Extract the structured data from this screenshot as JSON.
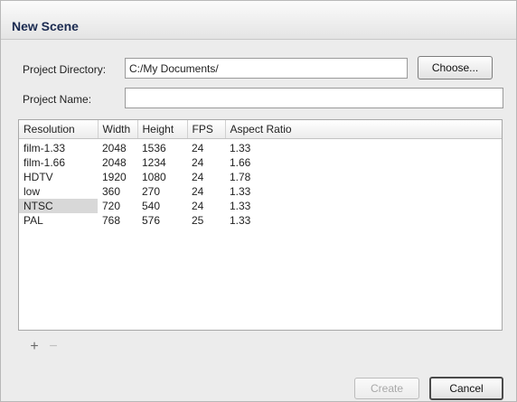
{
  "dialog": {
    "title": "New Scene"
  },
  "project_directory": {
    "label": "Project Directory:",
    "value": "C:/My Documents/"
  },
  "project_name": {
    "label": "Project Name:",
    "value": ""
  },
  "choose_button": "Choose...",
  "table": {
    "columns": [
      "Resolution",
      "Width",
      "Height",
      "FPS",
      "Aspect Ratio"
    ],
    "rows": [
      [
        "film-1.33",
        "2048",
        "1536",
        "24",
        "1.33"
      ],
      [
        "film-1.66",
        "2048",
        "1234",
        "24",
        "1.66"
      ],
      [
        "HDTV",
        "1920",
        "1080",
        "24",
        "1.78"
      ],
      [
        "low",
        "360",
        "270",
        "24",
        "1.33"
      ],
      [
        "NTSC",
        "720",
        "540",
        "24",
        "1.33"
      ],
      [
        "PAL",
        "768",
        "576",
        "25",
        "1.33"
      ]
    ],
    "selected_row": "NTSC"
  },
  "add_icon": {
    "icon": "plus-icon",
    "glyph": "+"
  },
  "remove_icon": {
    "icon": "minus-icon",
    "glyph": "−"
  },
  "create_button": "Create",
  "cancel_button": "Cancel"
}
